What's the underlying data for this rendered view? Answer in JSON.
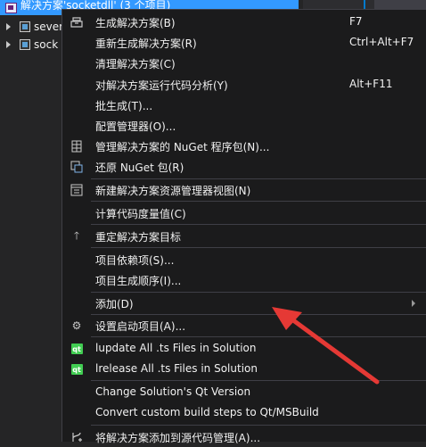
{
  "explorer": {
    "solution_label": "解决方案'socketdll' (3 个项目)",
    "projects": [
      "sever",
      "sock"
    ]
  },
  "menu": {
    "items": [
      {
        "label": "生成解决方案(B)",
        "shortcut": "F7",
        "icon": "build-icon"
      },
      {
        "label": "重新生成解决方案(R)",
        "shortcut": "Ctrl+Alt+F7",
        "icon": ""
      },
      {
        "label": "清理解决方案(C)",
        "shortcut": "",
        "icon": ""
      },
      {
        "label": "对解决方案运行代码分析(Y)",
        "shortcut": "Alt+F11",
        "icon": ""
      },
      {
        "label": "批生成(T)...",
        "shortcut": "",
        "icon": ""
      },
      {
        "label": "配置管理器(O)...",
        "shortcut": "",
        "icon": ""
      },
      {
        "label": "管理解决方案的 NuGet 程序包(N)...",
        "shortcut": "",
        "icon": "nuget-icon"
      },
      {
        "label": "还原 NuGet 包(R)",
        "shortcut": "",
        "icon": "restore-icon"
      },
      {
        "label": "新建解决方案资源管理器视图(N)",
        "shortcut": "",
        "icon": "new-view-icon"
      },
      {
        "label": "计算代码度量值(C)",
        "shortcut": "",
        "icon": ""
      },
      {
        "label": "重定解决方案目标",
        "shortcut": "",
        "icon": "up-arrow-icon"
      },
      {
        "label": "项目依赖项(S)...",
        "shortcut": "",
        "icon": ""
      },
      {
        "label": "项目生成顺序(I)...",
        "shortcut": "",
        "icon": ""
      },
      {
        "label": "添加(D)",
        "shortcut": "",
        "icon": ""
      },
      {
        "label": "设置启动项目(A)...",
        "shortcut": "",
        "icon": "gear-icon"
      },
      {
        "label": "lupdate All .ts Files in Solution",
        "shortcut": "",
        "icon": "qt-icon"
      },
      {
        "label": "lrelease All .ts Files in Solution",
        "shortcut": "",
        "icon": "qt-icon"
      },
      {
        "label": "Change Solution's Qt Version",
        "shortcut": "",
        "icon": ""
      },
      {
        "label": "Convert custom build steps to Qt/MSBuild",
        "shortcut": "",
        "icon": ""
      },
      {
        "label": "将解决方案添加到源代码管理(A)...",
        "shortcut": "",
        "icon": "source-control-icon"
      }
    ],
    "qt_glyph": "qt"
  },
  "colors": {
    "menu_bg": "#1b1b1c",
    "selection": "#3399ff",
    "annotation": "#e53935",
    "qt_green": "#41cd52"
  }
}
